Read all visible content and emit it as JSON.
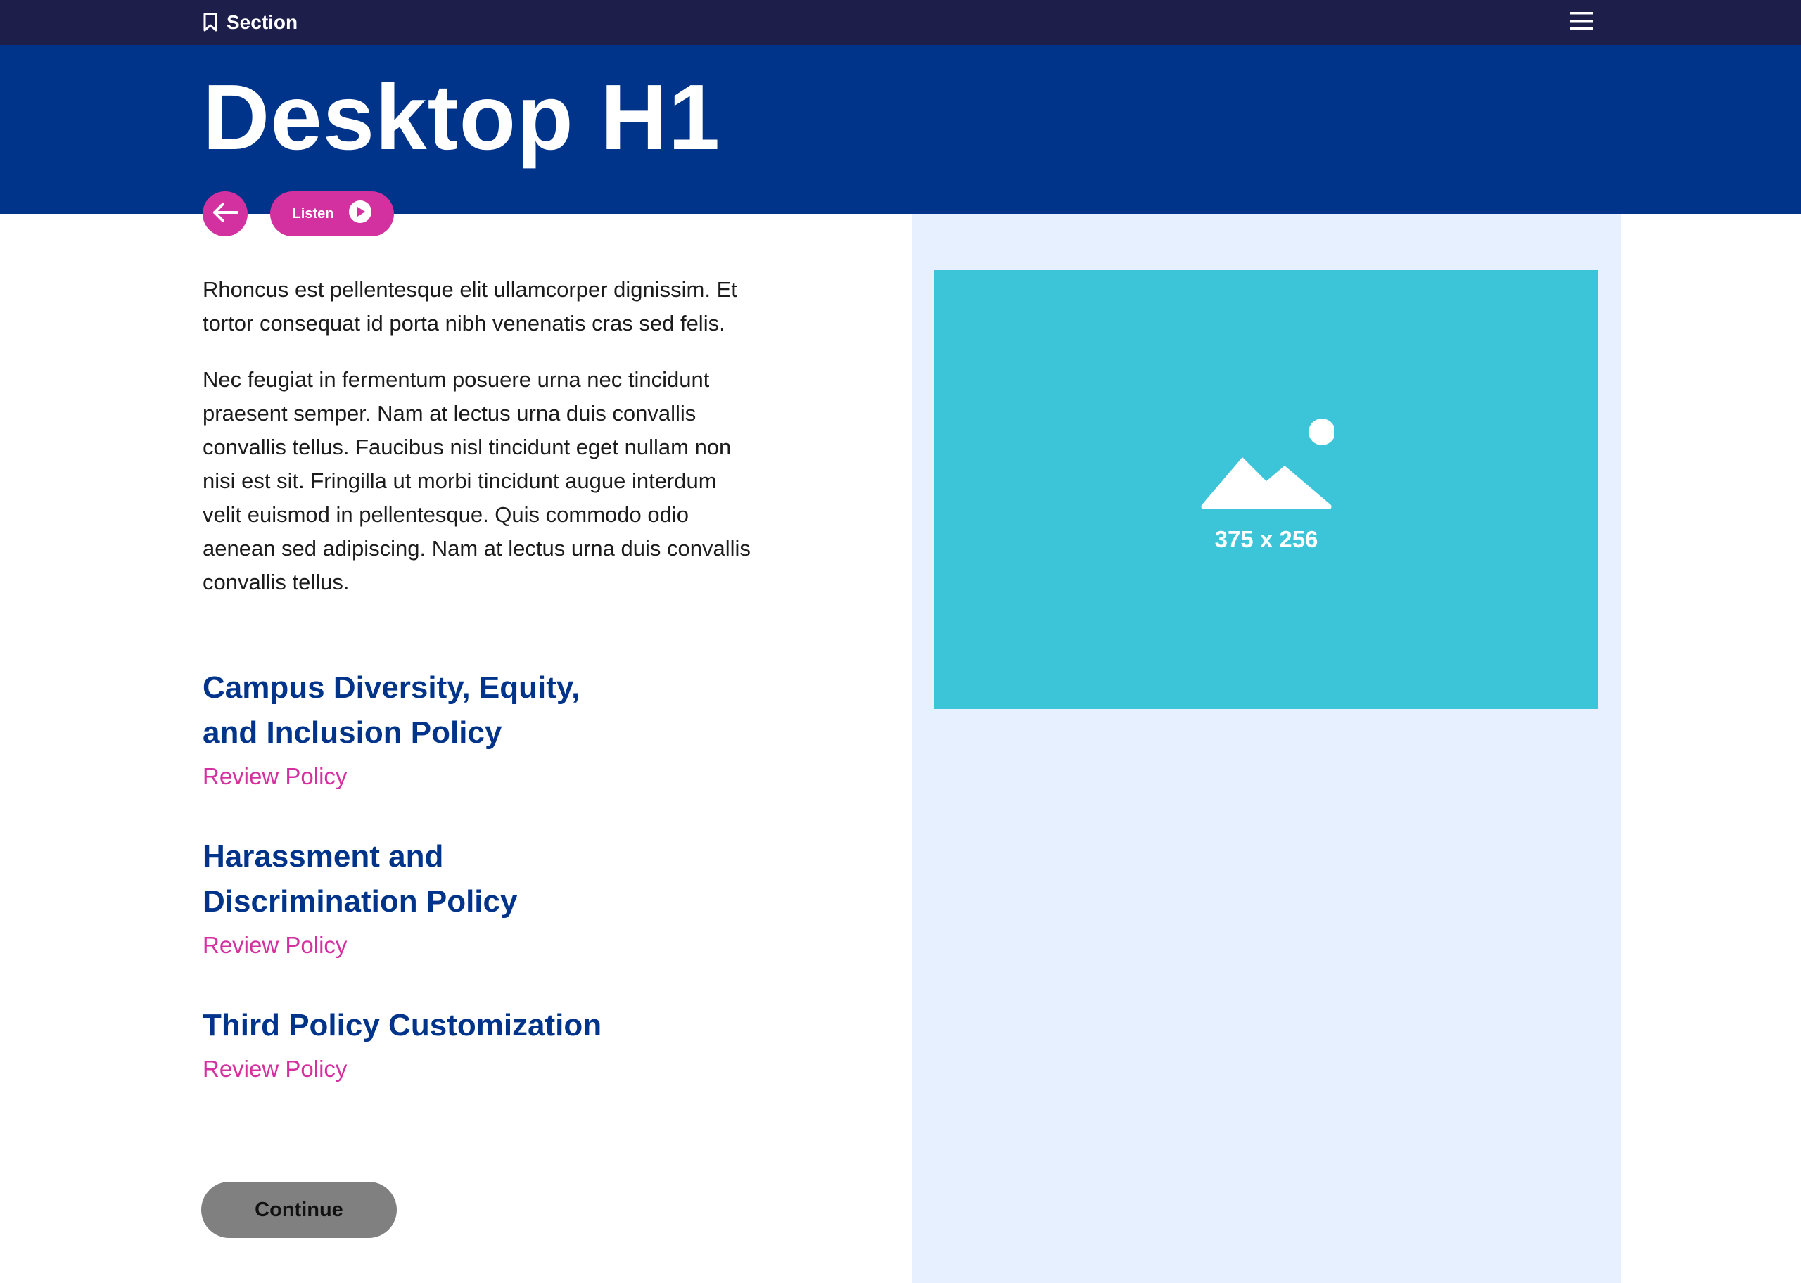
{
  "topbar": {
    "section_label": "Section",
    "bookmark_icon": "bookmark-icon",
    "menu_icon": "hamburger-menu-icon"
  },
  "hero": {
    "title": "Desktop H1"
  },
  "actions": {
    "back_icon": "arrow-left-icon",
    "listen_label": "Listen",
    "play_icon": "play-icon"
  },
  "body": {
    "paragraphs": [
      "Rhoncus est pellentesque elit ullamcorper dignissim. Et tortor consequat id porta nibh venenatis cras sed felis.",
      "Nec feugiat in fermentum posuere urna nec tincidunt praesent semper. Nam at lectus urna duis convallis convallis tellus. Faucibus nisl tincidunt eget nullam non nisi est sit. Fringilla ut morbi tincidunt augue interdum velit euismod in pellentesque. Quis commodo odio aenean sed adipiscing. Nam at lectus urna duis convallis convallis tellus."
    ]
  },
  "policies": [
    {
      "title_line1": "Campus Diversity, Equity,",
      "title_line2": "and Inclusion Policy",
      "link": "Review Policy"
    },
    {
      "title_line1": "Harassment and",
      "title_line2": "Discrimination Policy",
      "link": "Review Policy"
    },
    {
      "title_line1": "Third Policy Customization",
      "title_line2": "",
      "link": "Review Policy"
    }
  ],
  "image": {
    "size_label": "375 x 256",
    "icon": "image-placeholder-icon"
  },
  "continue_label": "Continue",
  "colors": {
    "topbar": "#1d1f4a",
    "hero": "#00348a",
    "accent": "#d3319f",
    "panel": "#e6f0fe",
    "image_bg": "#3cc5d9",
    "button_disabled": "#808080"
  }
}
